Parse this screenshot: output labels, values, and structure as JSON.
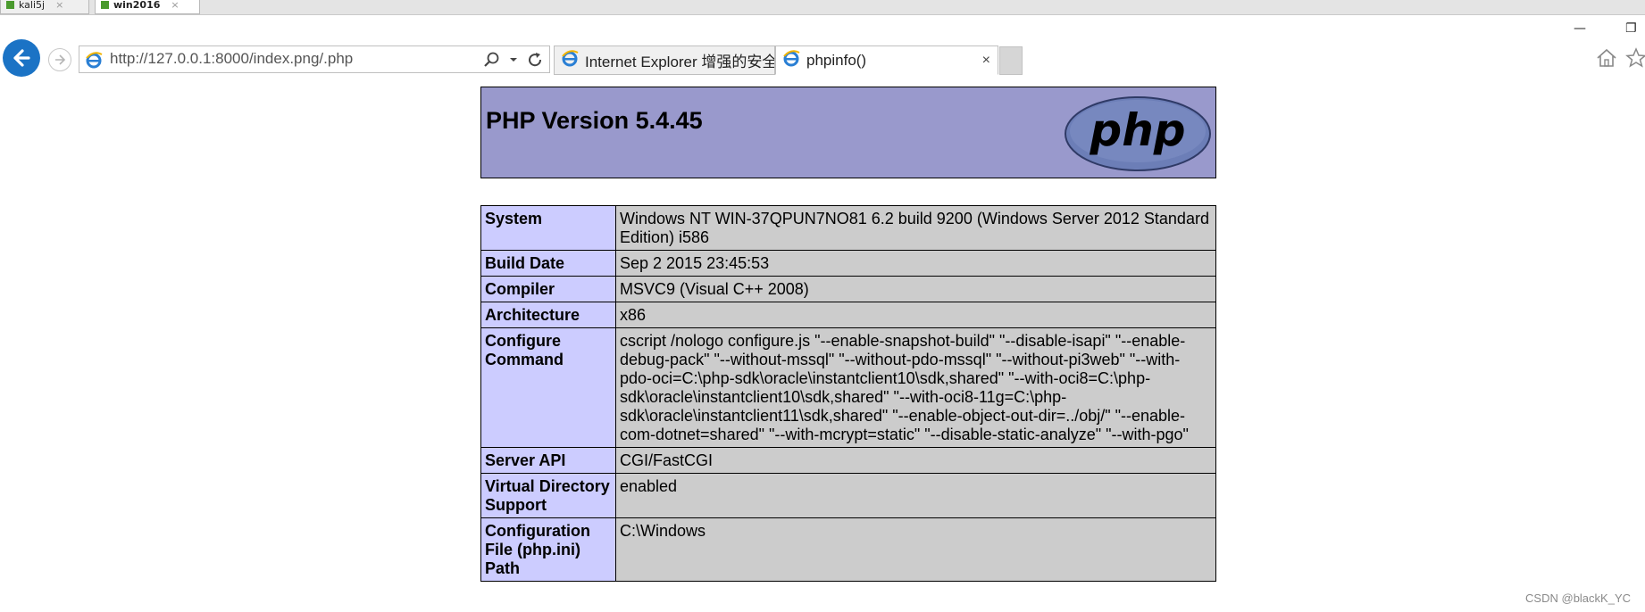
{
  "vm_tabs": [
    {
      "label": "kali5j"
    },
    {
      "label": "win2016"
    }
  ],
  "window_controls": {
    "minimize": "—",
    "restore": "❐"
  },
  "address_bar": {
    "url": "http://127.0.0.1:8000/index.png/.php"
  },
  "browser_tabs": [
    {
      "label": "Internet Explorer 增强的安全..."
    },
    {
      "label": "phpinfo()",
      "close": "×"
    }
  ],
  "php": {
    "version_title": "PHP Version 5.4.45",
    "logo_text": "php",
    "rows": [
      {
        "key": "System",
        "value": "Windows NT WIN-37QPUN7NO81 6.2 build 9200 (Windows Server 2012 Standard Edition) i586"
      },
      {
        "key": "Build Date",
        "value": "Sep 2 2015 23:45:53"
      },
      {
        "key": "Compiler",
        "value": "MSVC9 (Visual C++ 2008)"
      },
      {
        "key": "Architecture",
        "value": "x86"
      },
      {
        "key": "Configure Command",
        "value": "cscript /nologo configure.js \"--enable-snapshot-build\" \"--disable-isapi\" \"--enable-debug-pack\" \"--without-mssql\" \"--without-pdo-mssql\" \"--without-pi3web\" \"--with-pdo-oci=C:\\php-sdk\\oracle\\instantclient10\\sdk,shared\" \"--with-oci8=C:\\php-sdk\\oracle\\instantclient10\\sdk,shared\" \"--with-oci8-11g=C:\\php-sdk\\oracle\\instantclient11\\sdk,shared\" \"--enable-object-out-dir=../obj/\" \"--enable-com-dotnet=shared\" \"--with-mcrypt=static\" \"--disable-static-analyze\" \"--with-pgo\""
      },
      {
        "key": "Server API",
        "value": "CGI/FastCGI"
      },
      {
        "key": "Virtual Directory Support",
        "value": "enabled"
      },
      {
        "key": "Configuration File (php.ini) Path",
        "value": "C:\\Windows"
      }
    ]
  },
  "watermark": "CSDN @blackK_YC",
  "colors": {
    "php_header": "#9999cc",
    "key_cell": "#ccccff",
    "value_cell": "#cccccc",
    "back_button": "#1b73c5"
  }
}
